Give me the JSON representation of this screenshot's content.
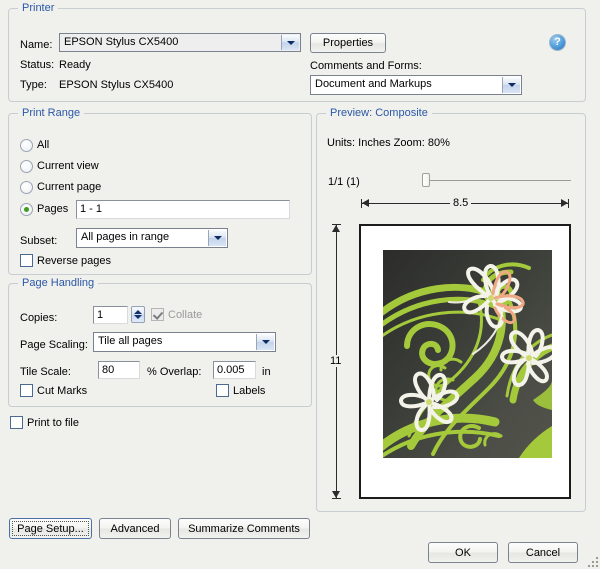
{
  "printer": {
    "legend": "Printer",
    "name_label": "Name:",
    "name_value": "EPSON Stylus CX5400",
    "status_label": "Status:",
    "status_value": "Ready",
    "type_label": "Type:",
    "type_value": "EPSON Stylus CX5400",
    "properties_button": "Properties",
    "comments_label": "Comments and Forms:",
    "comments_value": "Document and Markups",
    "help_icon": "?"
  },
  "print_range": {
    "legend": "Print Range",
    "option_all": "All",
    "option_current_view": "Current view",
    "option_current_page": "Current page",
    "option_pages": "Pages",
    "pages_value": "1 - 1",
    "selected_option": "Pages",
    "subset_label": "Subset:",
    "subset_value": "All pages in range",
    "reverse_pages": "Reverse pages",
    "reverse_checked": false
  },
  "page_handling": {
    "legend": "Page Handling",
    "copies_label": "Copies:",
    "copies_value": "1",
    "collate_label": "Collate",
    "collate_checked": true,
    "collate_disabled": true,
    "page_scaling_label": "Page Scaling:",
    "page_scaling_value": "Tile all pages",
    "tile_scale_label": "Tile Scale:",
    "tile_scale_value": "80",
    "percent_overlap_label": "% Overlap:",
    "overlap_value": "0.005",
    "overlap_unit": "in",
    "cut_marks_label": "Cut Marks",
    "cut_marks_checked": false,
    "labels_label": "Labels",
    "labels_checked": false
  },
  "print_to_file": {
    "label": "Print to file",
    "checked": false
  },
  "preview": {
    "legend": "Preview: Composite",
    "units_zoom": "Units: Inches  Zoom:  80%",
    "page_counter": "1/1 (1)",
    "width_dim": "8.5",
    "height_dim": "11",
    "slider_position_percent": 0
  },
  "buttons": {
    "page_setup": "Page Setup...",
    "advanced": "Advanced",
    "summarize_comments": "Summarize Comments",
    "ok": "OK",
    "cancel": "Cancel",
    "focused": "Page Setup..."
  },
  "colors": {
    "legend_blue": "#2a58a8",
    "artwork_green": "#a4ca3c",
    "artwork_background": "#3b3d39",
    "artwork_white": "#f4f3ea",
    "artwork_salmon": "#f0a784",
    "radio_dot_green": "#3d9e18"
  }
}
